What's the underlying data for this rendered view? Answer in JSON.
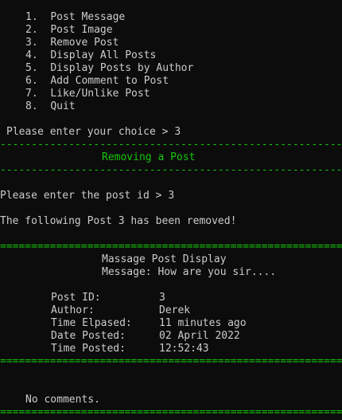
{
  "colors": {
    "background": "#0c0c0c",
    "text": "#cccccc",
    "accent_green": "#16c60c"
  },
  "menu": {
    "items": [
      {
        "number": "1.",
        "label": "Post Message"
      },
      {
        "number": "2.",
        "label": "Post Image"
      },
      {
        "number": "3.",
        "label": "Remove Post"
      },
      {
        "number": "4.",
        "label": "Display All Posts"
      },
      {
        "number": "5.",
        "label": "Display Posts by Author"
      },
      {
        "number": "6.",
        "label": "Add Comment to Post"
      },
      {
        "number": "7.",
        "label": "Like/Unlike Post"
      },
      {
        "number": "8.",
        "label": "Quit"
      }
    ]
  },
  "prompt": {
    "text": "Please enter your choice > 3"
  },
  "separators": {
    "dash": "--------------------------------------------------------------------",
    "equals": "===================================================================="
  },
  "section": {
    "title": "Removing a Post"
  },
  "post_id_prompt": {
    "text": "Please enter the post id > 3"
  },
  "result": {
    "text": "The following Post 3 has been removed!"
  },
  "post_display": {
    "header": "Massage Post Display",
    "message_label": "Message:",
    "message_value": "How are you sir....",
    "fields": [
      {
        "label": "Post ID:",
        "value": "3"
      },
      {
        "label": "Author:",
        "value": "Derek"
      },
      {
        "label": "Time Elpased:",
        "value": "11 minutes ago"
      },
      {
        "label": "Date Posted:",
        "value": "02 April 2022"
      },
      {
        "label": "Time Posted:",
        "value": "12:52:43"
      }
    ]
  },
  "comments": {
    "text": "No comments."
  }
}
